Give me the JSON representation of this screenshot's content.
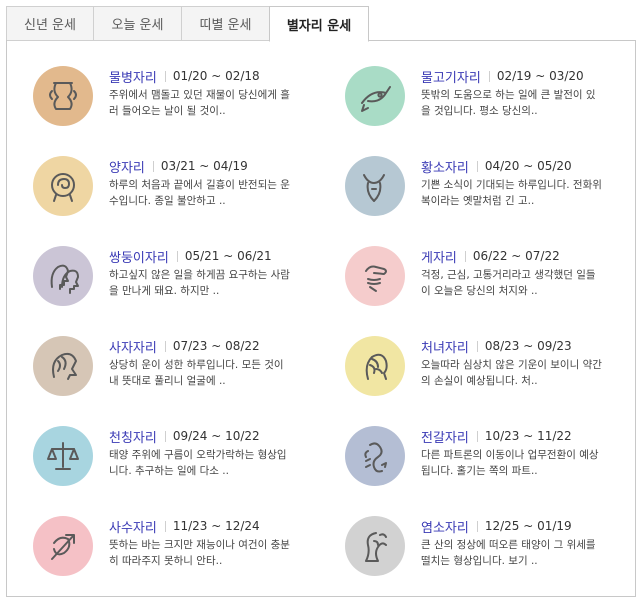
{
  "tabs": [
    {
      "label": "신년 운세"
    },
    {
      "label": "오늘 운세"
    },
    {
      "label": "띠별 운세"
    },
    {
      "label": "별자리 운세",
      "active": true
    }
  ],
  "signs": [
    {
      "name": "물병자리",
      "dates": "01/20 ~ 02/18",
      "line1": "주위에서 맴돌고 있던 재물이 당신에게 흘",
      "line2": "러 들어오는 날이 될 것이..",
      "color": "#e2b98d",
      "icon": "aquarius-icon"
    },
    {
      "name": "물고기자리",
      "dates": "02/19 ~ 03/20",
      "line1": "뜻밖의 도움으로 하는 일에 큰 발전이 있",
      "line2": "을 것입니다. 평소 당신의..",
      "color": "#a9dcc6",
      "icon": "pisces-icon"
    },
    {
      "name": "양자리",
      "dates": "03/21 ~ 04/19",
      "line1": "하루의 처음과 끝에서 길흉이 반전되는 운",
      "line2": "수입니다. 종일 불안하고 ..",
      "color": "#efd6a3",
      "icon": "aries-icon"
    },
    {
      "name": "황소자리",
      "dates": "04/20 ~ 05/20",
      "line1": "기쁜 소식이 기대되는 하루입니다. 전화위",
      "line2": "복이라는 옛말처럼 긴 고..",
      "color": "#b6c8d3",
      "icon": "taurus-icon"
    },
    {
      "name": "쌍둥이자리",
      "dates": "05/21 ~ 06/21",
      "line1": "하고싶지 않은 일을 하게끔 요구하는 사람",
      "line2": "을 만나게 돼요. 하지만 ..",
      "color": "#cbc5d6",
      "icon": "gemini-icon"
    },
    {
      "name": "게자리",
      "dates": "06/22 ~ 07/22",
      "line1": "걱정, 근심, 고통거리라고 생각했던 일들",
      "line2": "이 오늘은 당신의 처지와 ..",
      "color": "#f5cccc",
      "icon": "cancer-icon"
    },
    {
      "name": "사자자리",
      "dates": "07/23 ~ 08/22",
      "line1": "상당히 운이 성한 하루입니다. 모든 것이",
      "line2": "내 뜻대로 풀리니 얼굴에 ..",
      "color": "#d6c6b6",
      "icon": "leo-icon"
    },
    {
      "name": "처녀자리",
      "dates": "08/23 ~ 09/23",
      "line1": "오늘따라 심상치 않은 기운이 보이니 약간",
      "line2": "의 손실이 예상됩니다. 처..",
      "color": "#f1e6a3",
      "icon": "virgo-icon"
    },
    {
      "name": "천칭자리",
      "dates": "09/24 ~ 10/22",
      "line1": "태양 주위에 구름이 오락가락하는 형상입",
      "line2": "니다. 추구하는 일에 다소 ..",
      "color": "#a8d5e0",
      "icon": "libra-icon"
    },
    {
      "name": "전갈자리",
      "dates": "10/23 ~ 11/22",
      "line1": "다른 파트론의 이동이나 업무전환이 예상",
      "line2": "됩니다. 홀기는 쪽의 파트..",
      "color": "#b4bed4",
      "icon": "scorpio-icon"
    },
    {
      "name": "사수자리",
      "dates": "11/23 ~ 12/24",
      "line1": "뜻하는 바는 크지만 재능이나 여건이 충분",
      "line2": "히 따라주지 못하니 안타..",
      "color": "#f5c1c6",
      "icon": "sagittarius-icon"
    },
    {
      "name": "염소자리",
      "dates": "12/25 ~ 01/19",
      "line1": "큰 산의 정상에 떠오른 태양이 그 위세를",
      "line2": "떨치는 형상입니다. 보기 ..",
      "color": "#d2d2d2",
      "icon": "capricorn-icon"
    }
  ]
}
